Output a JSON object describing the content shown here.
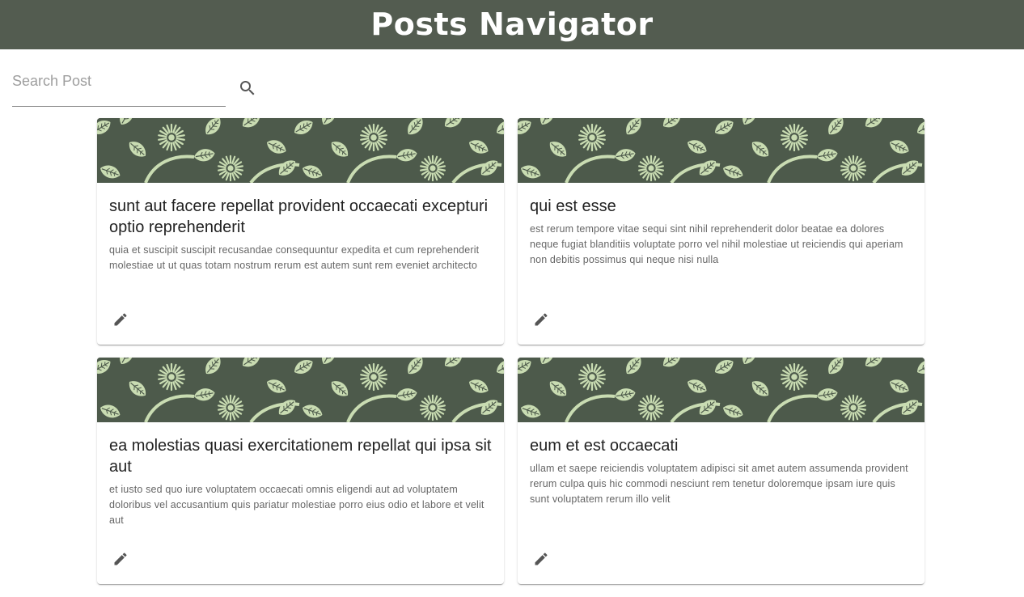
{
  "header": {
    "title": "Posts Navigator",
    "background_color": "#535c50"
  },
  "search": {
    "placeholder": "Search Post",
    "value": "",
    "icon": "search-icon"
  },
  "theme": {
    "media_background": "#4d5a4b",
    "media_pattern_color": "#c9dcb2",
    "icon_color": "#555555"
  },
  "posts": [
    {
      "title": "sunt aut facere repellat provident occaecati excepturi optio reprehenderit",
      "body": "quia et suscipit suscipit recusandae consequuntur expedita et cum reprehenderit molestiae ut ut quas totam nostrum rerum est autem sunt rem eveniet architecto",
      "action_icon": "pencil-icon"
    },
    {
      "title": "qui est esse",
      "body": "est rerum tempore vitae sequi sint nihil reprehenderit dolor beatae ea dolores neque fugiat blanditiis voluptate porro vel nihil molestiae ut reiciendis qui aperiam non debitis possimus qui neque nisi nulla",
      "action_icon": "pencil-icon"
    },
    {
      "title": "ea molestias quasi exercitationem repellat qui ipsa sit aut",
      "body": "et iusto sed quo iure voluptatem occaecati omnis eligendi aut ad voluptatem doloribus vel accusantium quis pariatur molestiae porro eius odio et labore et velit aut",
      "action_icon": "pencil-icon"
    },
    {
      "title": "eum et est occaecati",
      "body": "ullam et saepe reiciendis voluptatem adipisci sit amet autem assumenda provident rerum culpa quis hic commodi nesciunt rem tenetur doloremque ipsam iure quis sunt voluptatem rerum illo velit",
      "action_icon": "pencil-icon"
    }
  ]
}
